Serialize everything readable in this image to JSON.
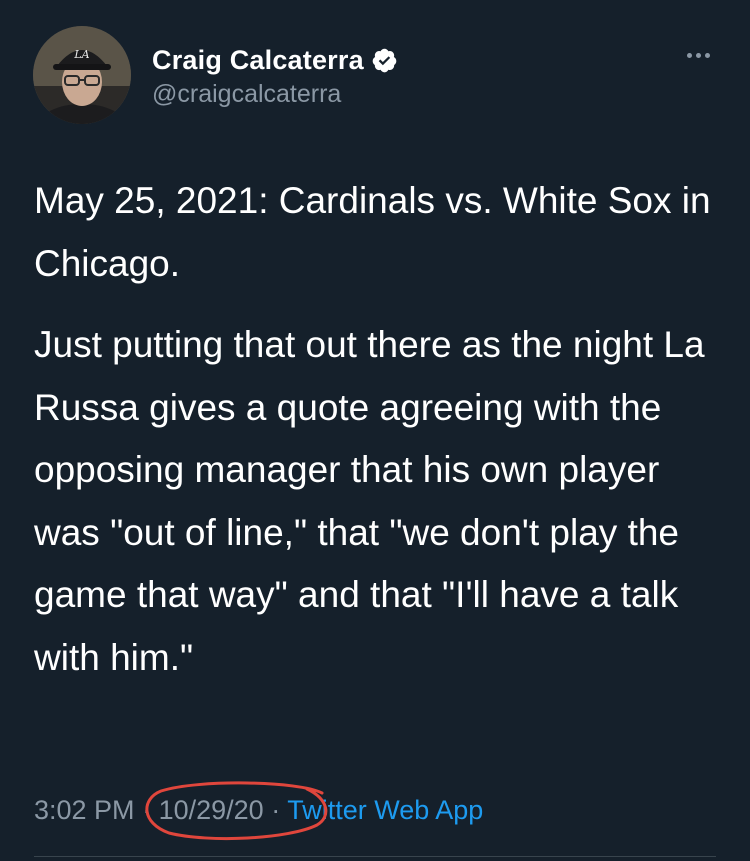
{
  "user": {
    "display_name": "Craig Calcaterra",
    "handle": "@craigcalcaterra",
    "verified": true,
    "avatar_cap_logo": "LA"
  },
  "tweet": {
    "paragraphs": [
      "May 25, 2021: Cardinals vs. White Sox in Chicago.",
      "Just putting that out there as the night La Russa gives a quote agreeing with the opposing manager that his own player was \"out of line,\" that \"we don't play the game that way\" and that \"I'll have a talk with him.\""
    ]
  },
  "meta": {
    "time": "3:02 PM",
    "separator": "·",
    "date": "10/29/20",
    "source": "Twitter Web App"
  },
  "icons": {
    "verified": "verified-badge-icon",
    "more": "more-dots-icon"
  },
  "colors": {
    "background": "#15202b",
    "text": "#ffffff",
    "secondary_text": "#8b98a5",
    "link": "#1d9bf0",
    "annotation_circle": "#e0463c"
  }
}
